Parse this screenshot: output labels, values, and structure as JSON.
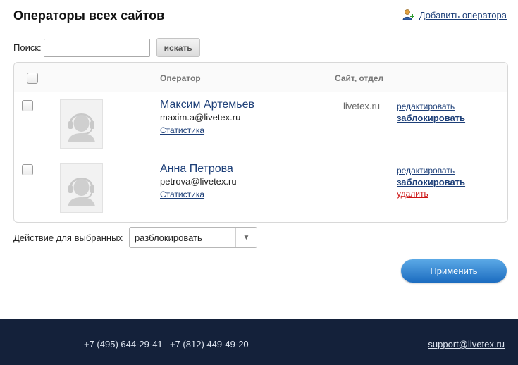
{
  "header": {
    "title": "Операторы всех сайтов",
    "add_operator_label": "Добавить оператора"
  },
  "search": {
    "label": "Поиск:",
    "value": "",
    "placeholder": "",
    "button_label": "искать"
  },
  "table": {
    "columns": {
      "operator": "Оператор",
      "site": "Сайт, отдел"
    },
    "rows": [
      {
        "name": "Максим Артемьев",
        "email": "maxim.a@livetex.ru",
        "stats_label": "Статистика",
        "site": "livetex.ru",
        "edit_label": "редактировать",
        "block_label": "заблокировать",
        "delete_label": ""
      },
      {
        "name": "Анна Петрова",
        "email": "petrova@livetex.ru",
        "stats_label": "Статистика",
        "site": "",
        "edit_label": "редактировать",
        "block_label": "заблокировать",
        "delete_label": "удалить"
      }
    ]
  },
  "bulk": {
    "label": "Действие для выбранных",
    "selected": "разблокировать",
    "apply_label": "Применить"
  },
  "footer": {
    "phone_moscow": "+7 (495) 644-29-41",
    "phone_spb": "+7 (812) 449-49-20",
    "support_email": "support@livetex.ru"
  },
  "icons": {
    "add_operator": "user-add-icon",
    "avatar": "operator-headset-icon",
    "dropdown": "triangle-down-icon"
  },
  "colors": {
    "link": "#1d3f78",
    "danger": "#cc1111",
    "footer_bg": "#14213a",
    "apply_btn": "#2a7fd0"
  }
}
